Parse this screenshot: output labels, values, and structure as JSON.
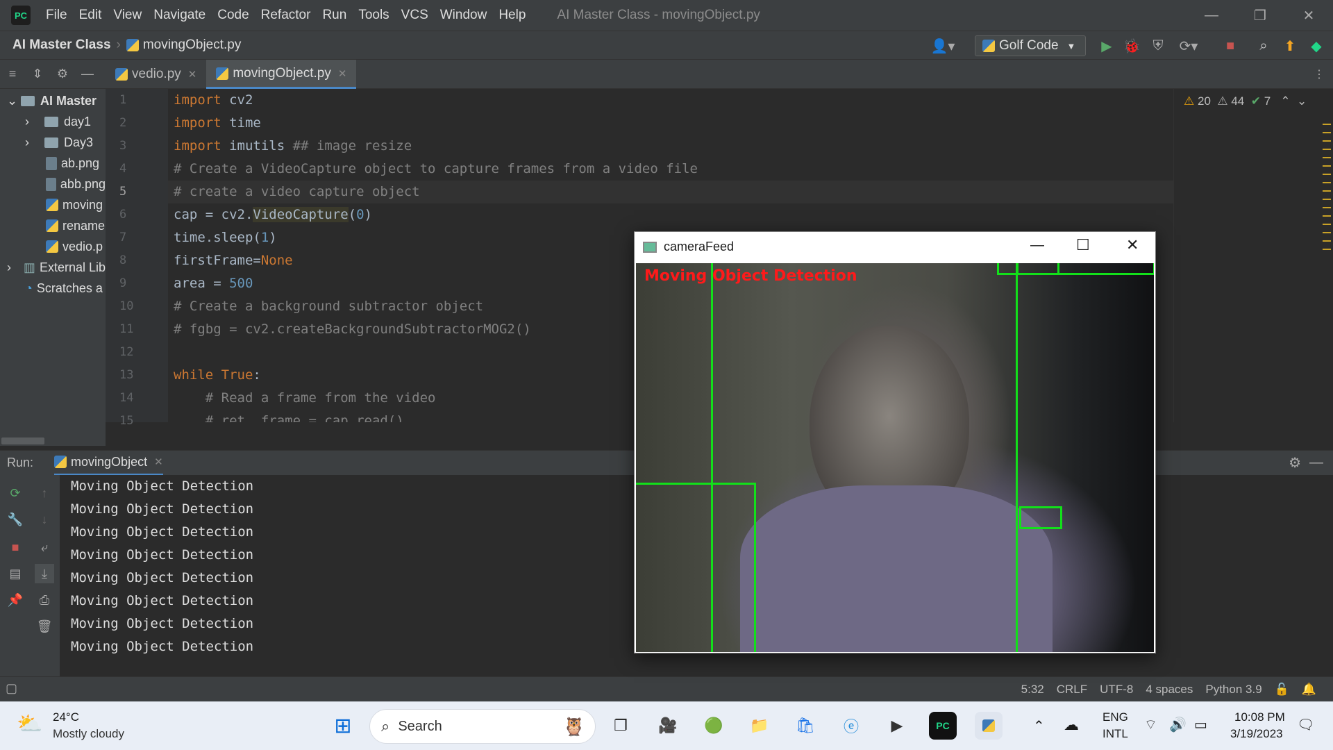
{
  "app": {
    "window_title": "AI Master Class - movingObject.py",
    "menu": [
      "File",
      "Edit",
      "View",
      "Navigate",
      "Code",
      "Refactor",
      "Run",
      "Tools",
      "VCS",
      "Window",
      "Help"
    ]
  },
  "navbar": {
    "project": "AI Master Class",
    "file": "movingObject.py",
    "run_config": "Golf Code"
  },
  "project_tree": {
    "root": "AI Master",
    "items": [
      "day1",
      "Day3",
      "ab.png",
      "abb.png",
      "moving",
      "rename",
      "vedio.p"
    ],
    "external": "External Lib",
    "scratches": "Scratches a"
  },
  "tabs": [
    "vedio.py",
    "movingObject.py"
  ],
  "editor": {
    "line_numbers": [
      "1",
      "2",
      "3",
      "4",
      "5",
      "6",
      "7",
      "8",
      "9",
      "10",
      "11",
      "12",
      "13",
      "14",
      "15"
    ],
    "current_line": 5,
    "inspections": {
      "warnings": "20",
      "weak_warnings": "44",
      "typos": "7"
    }
  },
  "run": {
    "label": "Run:",
    "tab": "movingObject",
    "output": [
      "Moving Object Detection",
      "Moving Object Detection",
      "Moving Object Detection",
      "Moving Object Detection",
      "Moving Object Detection",
      "Moving Object Detection",
      "Moving Object Detection",
      "Moving Object Detection"
    ]
  },
  "status": {
    "position": "5:32",
    "line_sep": "CRLF",
    "encoding": "UTF-8",
    "indent": "4 spaces",
    "interpreter": "Python 3.9"
  },
  "camera_window": {
    "title": "cameraFeed",
    "overlay_text": "Moving Object Detection"
  },
  "taskbar": {
    "temperature": "24°C",
    "weather": "Mostly cloudy",
    "search_placeholder": "Search",
    "lang1": "ENG",
    "lang2": "INTL",
    "time": "10:08 PM",
    "date": "3/19/2023"
  },
  "colors": {
    "accent": "#4a88c7",
    "box": "#12e01a",
    "overlay_text": "#ff1a1a"
  }
}
